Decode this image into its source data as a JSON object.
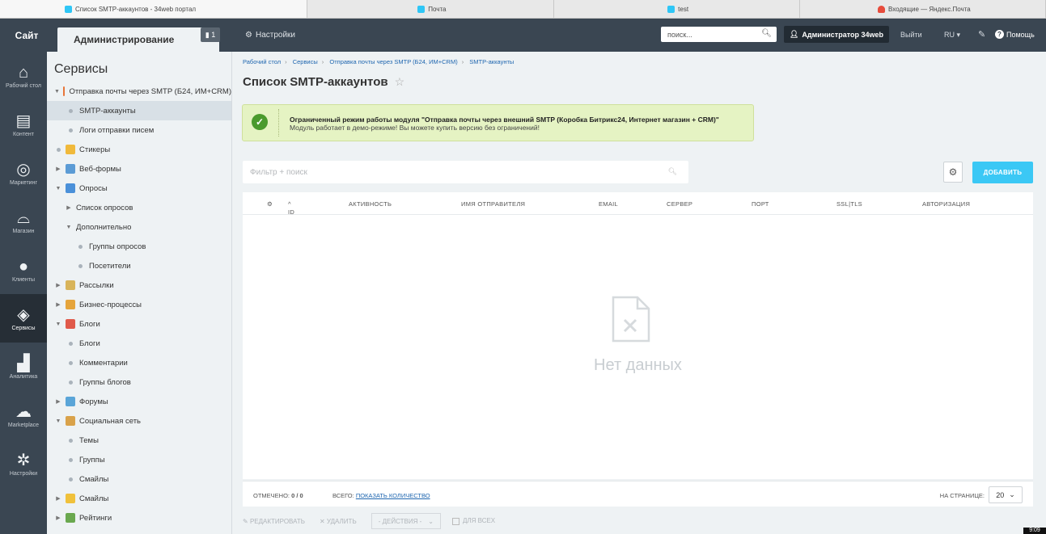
{
  "browser_tabs": [
    {
      "label": "Список SMTP-аккаунтов - 34web портал",
      "icon": "bitrix-icon"
    },
    {
      "label": "Почта",
      "icon": "bitrix-icon"
    },
    {
      "label": "test",
      "icon": "bitrix-icon"
    },
    {
      "label": "Входящие — Яндекс.Почта",
      "icon": "yandex-mail-icon"
    }
  ],
  "topbar": {
    "site": "Сайт",
    "admin": "Администрирование",
    "notif_count": "1",
    "settings": "Настройки",
    "search_placeholder": "поиск...",
    "user": "Администратор 34web",
    "logout": "Выйти",
    "lang": "RU",
    "help": "Помощь"
  },
  "leftnav": [
    {
      "label": "Рабочий стол",
      "icon": "home-icon"
    },
    {
      "label": "Контент",
      "icon": "document-icon"
    },
    {
      "label": "Маркетинг",
      "icon": "target-icon"
    },
    {
      "label": "Магазин",
      "icon": "cart-icon"
    },
    {
      "label": "Клиенты",
      "icon": "clients-icon"
    },
    {
      "label": "Сервисы",
      "icon": "layers-icon",
      "active": true
    },
    {
      "label": "Аналитика",
      "icon": "bar-chart-icon"
    },
    {
      "label": "Marketplace",
      "icon": "cloud-upload-icon"
    },
    {
      "label": "Настройки",
      "icon": "gear-icon"
    }
  ],
  "sidebar": {
    "title": "Сервисы",
    "items": [
      {
        "label": "Отправка почты через SMTP (Б24, ИМ+CRM)",
        "level": 0,
        "arrow": "▼",
        "icon": "smtp-icon"
      },
      {
        "label": "SMTP-аккаунты",
        "level": 1,
        "selected": true
      },
      {
        "label": "Логи отправки писем",
        "level": 1
      },
      {
        "label": "Стикеры",
        "level": 0,
        "arrow": "",
        "icon": "sticker-icon"
      },
      {
        "label": "Веб-формы",
        "level": 0,
        "arrow": "▶",
        "icon": "form-icon"
      },
      {
        "label": "Опросы",
        "level": 0,
        "arrow": "▼",
        "icon": "pie-icon"
      },
      {
        "label": "Список опросов",
        "level": 1,
        "arrow": "▶"
      },
      {
        "label": "Дополнительно",
        "level": 1,
        "arrow": "▼"
      },
      {
        "label": "Группы опросов",
        "level": 2
      },
      {
        "label": "Посетители",
        "level": 2
      },
      {
        "label": "Рассылки",
        "level": 0,
        "arrow": "▶",
        "icon": "mail-icon"
      },
      {
        "label": "Бизнес-процессы",
        "level": 0,
        "arrow": "▶",
        "icon": "process-icon"
      },
      {
        "label": "Блоги",
        "level": 0,
        "arrow": "▼",
        "icon": "blog-icon"
      },
      {
        "label": "Блоги",
        "level": 1
      },
      {
        "label": "Комментарии",
        "level": 1
      },
      {
        "label": "Группы блогов",
        "level": 1
      },
      {
        "label": "Форумы",
        "level": 0,
        "arrow": "▶",
        "icon": "forum-icon"
      },
      {
        "label": "Социальная сеть",
        "level": 0,
        "arrow": "▼",
        "icon": "social-icon"
      },
      {
        "label": "Темы",
        "level": 1
      },
      {
        "label": "Группы",
        "level": 1
      },
      {
        "label": "Смайлы",
        "level": 1
      },
      {
        "label": "Смайлы",
        "level": 0,
        "arrow": "▶",
        "icon": "smile-icon"
      },
      {
        "label": "Рейтинги",
        "level": 0,
        "arrow": "▶",
        "icon": "rating-icon"
      }
    ]
  },
  "breadcrumbs": [
    "Рабочий стол",
    "Сервисы",
    "Отправка почты через SMTP (Б24, ИМ+CRM)",
    "SMTP-аккаунты"
  ],
  "page_title": "Список SMTP-аккаунтов",
  "alert": {
    "title": "Ограниченный режим работы модуля \"Отправка почты через внешний SMTP (Коробка Битрикс24, Интернет магазин + CRM)\"",
    "text": "Модуль работает в демо-режиме! Вы можете купить версию без ограничений!"
  },
  "filter_placeholder": "Фильтр + поиск",
  "add_button": "ДОБАВИТЬ",
  "grid": {
    "columns": [
      "ID",
      "АКТИВНОСТЬ",
      "ИМЯ ОТПРАВИТЕЛЯ",
      "EMAIL",
      "СЕРВЕР",
      "ПОРТ",
      "SSL|TLS",
      "АВТОРИЗАЦИЯ"
    ],
    "empty_text": "Нет данных"
  },
  "footer": {
    "selected_label": "ОТМЕЧЕНО:",
    "selected_value": "0 / 0",
    "total_label": "ВСЕГО:",
    "total_link": "ПОКАЗАТЬ КОЛИЧЕСТВО",
    "per_page_label": "НА СТРАНИЦЕ:",
    "per_page_value": "20"
  },
  "actions": {
    "edit": "РЕДАКТИРОВАТЬ",
    "delete": "УДАЛИТЬ",
    "dropdown": "- ДЕЙСТВИЯ -",
    "for_all": "ДЛЯ ВСЕХ"
  },
  "clock": "9:09",
  "colors": {
    "accent": "#3bc8f5",
    "topbar": "#3a4652",
    "alert_bg": "#e5f3c3"
  }
}
